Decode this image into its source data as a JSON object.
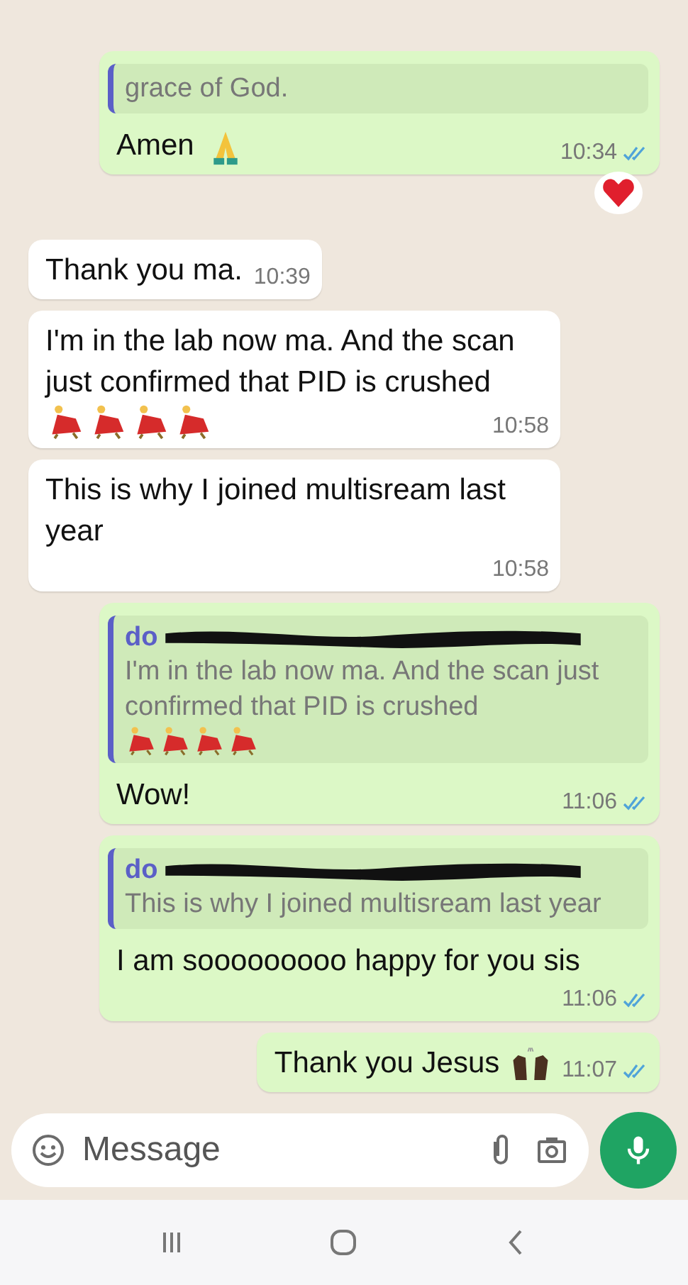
{
  "messages": [
    {
      "kind": "outgoing",
      "quote": {
        "text": "grace of God."
      },
      "text": "Amen",
      "emojis": [
        {
          "kind": "praying-hands"
        }
      ],
      "time": "10:34",
      "read": true,
      "reaction": {
        "kind": "heart"
      }
    },
    {
      "kind": "incoming",
      "text": "Thank you ma.",
      "time": "10:39"
    },
    {
      "kind": "incoming",
      "text": "I'm in the lab now ma. And the scan just confirmed that PID is crushed",
      "emojis": [
        {
          "kind": "dancer"
        },
        {
          "kind": "dancer"
        },
        {
          "kind": "dancer"
        },
        {
          "kind": "dancer"
        }
      ],
      "time": "10:58"
    },
    {
      "kind": "incoming",
      "text": "This is why I joined multisream last year",
      "time": "10:58"
    },
    {
      "kind": "outgoing",
      "quote": {
        "author": "do",
        "text": "I'm in the lab now ma. And the scan just confirmed that PID is crushed",
        "emojis": [
          {
            "kind": "dancer"
          },
          {
            "kind": "dancer"
          },
          {
            "kind": "dancer"
          },
          {
            "kind": "dancer"
          }
        ]
      },
      "text": "Wow!",
      "time": "11:06",
      "read": true
    },
    {
      "kind": "outgoing",
      "quote": {
        "author": "do",
        "text": "This is why I joined multisream last year"
      },
      "text": "I am sooooooooo happy for you sis",
      "time": "11:06",
      "read": true
    },
    {
      "kind": "outgoing",
      "text": "Thank you Jesus",
      "emojis": [
        {
          "kind": "raised-hands"
        }
      ],
      "time": "11:07",
      "read": true
    }
  ],
  "composer": {
    "placeholder": "Message"
  }
}
